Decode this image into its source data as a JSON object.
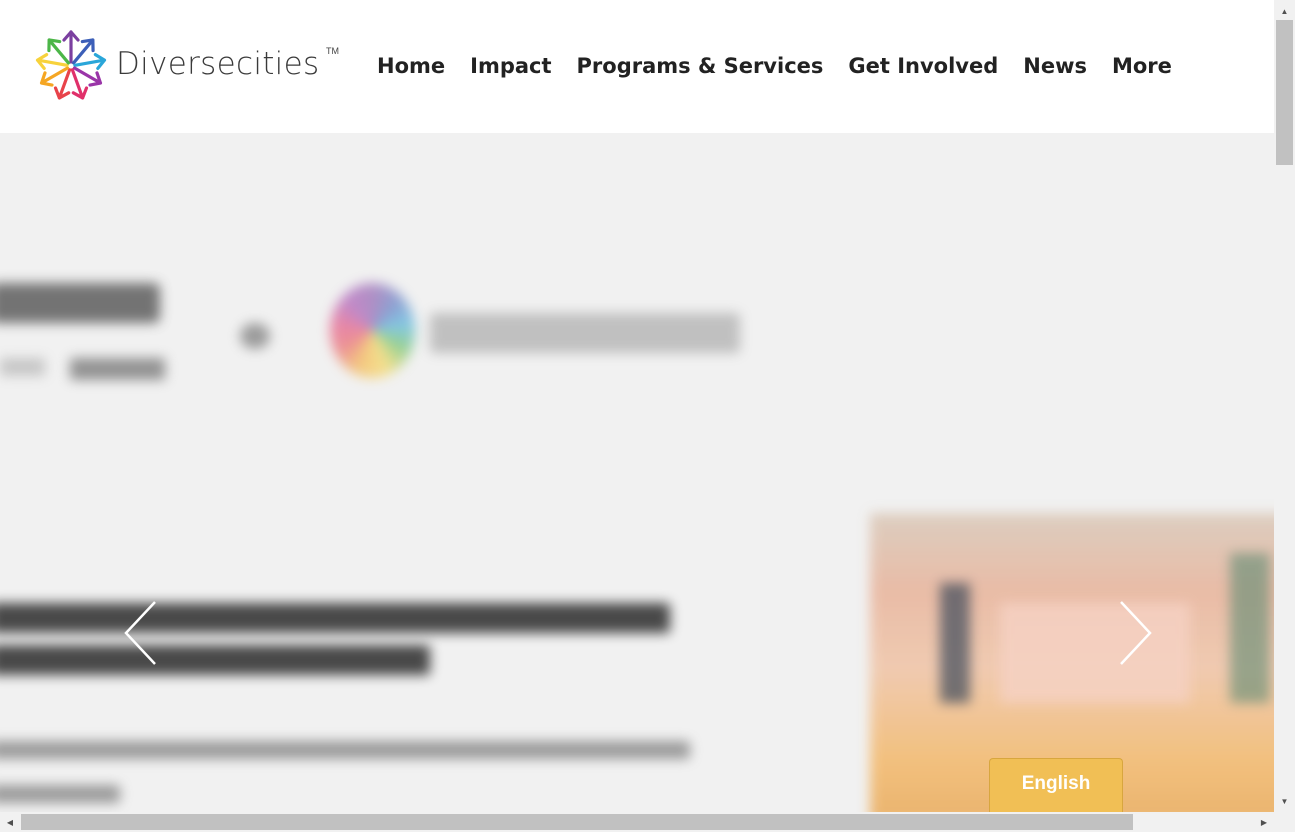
{
  "header": {
    "logo_text": "Diversecities",
    "logo_tm": "TM",
    "nav": [
      {
        "label": "Home"
      },
      {
        "label": "Impact"
      },
      {
        "label": "Programs & Services"
      },
      {
        "label": "Get Involved"
      },
      {
        "label": "News"
      },
      {
        "label": "More"
      }
    ]
  },
  "hero": {
    "prev_icon": "chevron-left-icon",
    "next_icon": "chevron-right-icon"
  },
  "language_button": {
    "label": "English"
  },
  "colors": {
    "accent": "#f1bf55",
    "nav_text": "#222222",
    "hero_bg": "#f1f1f1"
  }
}
